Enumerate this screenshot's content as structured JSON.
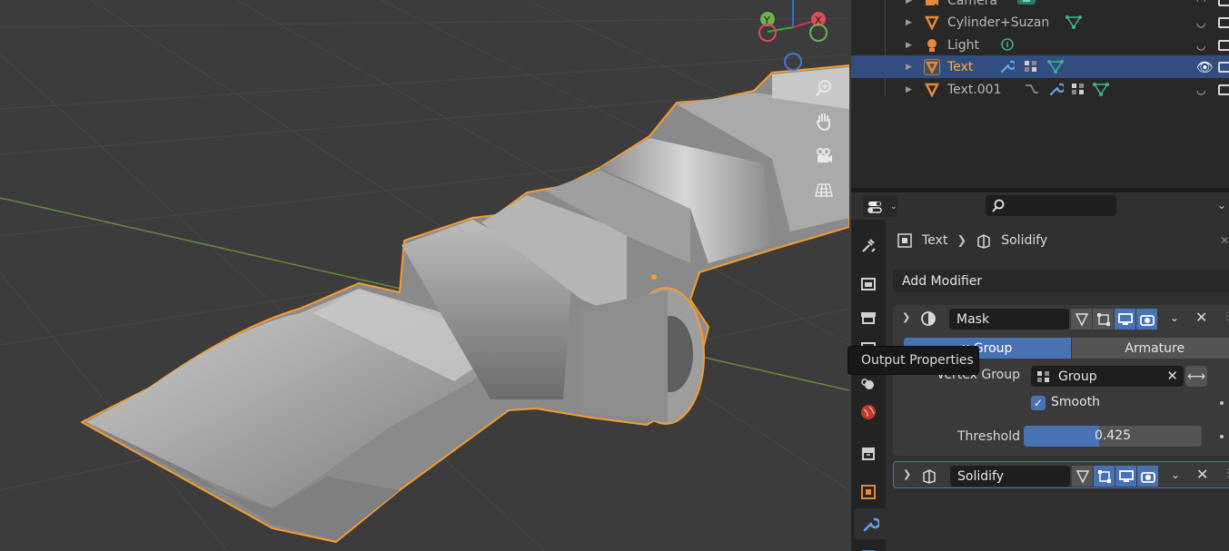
{
  "outliner": {
    "items": [
      {
        "name": "Camera",
        "icon": "camera-icon",
        "selected": false
      },
      {
        "name": "Cylinder+Suzan",
        "icon": "mesh-icon",
        "selected": false
      },
      {
        "name": "Light",
        "icon": "light-icon",
        "selected": false
      },
      {
        "name": "Text",
        "icon": "text-object-icon",
        "selected": true
      },
      {
        "name": "Text.001",
        "icon": "text-object-icon",
        "selected": false
      }
    ]
  },
  "properties": {
    "tooltip": "Output Properties",
    "breadcrumb": {
      "object": "Text",
      "modifier": "Solidify"
    },
    "add_modifier": "Add Modifier",
    "mask": {
      "name": "Mask",
      "mode_options": [
        "Vertex Group",
        "Armature"
      ],
      "mode_visible": [
        "x Group",
        "Armature"
      ],
      "vertex_group_label": "Vertex Group",
      "vertex_group_value": "Group",
      "smooth_label": "Smooth",
      "smooth_checked": true,
      "threshold_label": "Threshold",
      "threshold_value": "0.425",
      "threshold_fraction": 0.425
    },
    "solidify": {
      "name": "Solidify"
    }
  },
  "colors": {
    "selection_outline": "#f39c33",
    "accent": "#4772b3",
    "active_name": "#ffad33"
  }
}
